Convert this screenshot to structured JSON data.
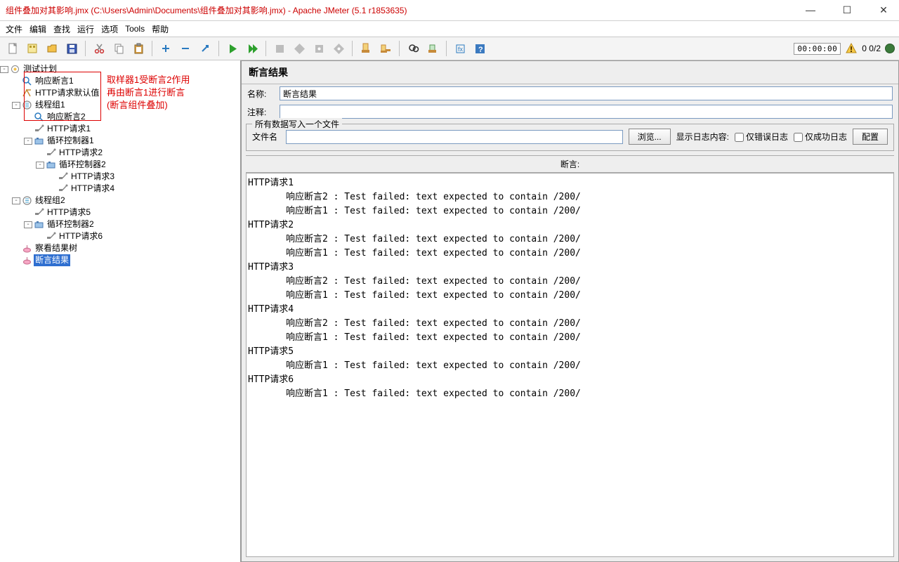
{
  "window": {
    "title": "组件叠加对其影响.jmx (C:\\Users\\Admin\\Documents\\组件叠加对其影响.jmx) - Apache JMeter (5.1 r1853635)"
  },
  "menu": {
    "file": "文件",
    "edit": "编辑",
    "search": "查找",
    "run": "运行",
    "options": "选项",
    "tools": "Tools",
    "help": "帮助"
  },
  "status": {
    "timer": "00:00:00",
    "counter": "0 0/2"
  },
  "annotation": {
    "line1": "取样器1受断言2作用",
    "line2": "再由断言1进行断言",
    "line3": "(断言组件叠加)"
  },
  "tree": {
    "root": "测试计划",
    "n1": "响应断言1",
    "n2": "HTTP请求默认值",
    "n3": "线程组1",
    "n3a": "响应断言2",
    "n3b": "HTTP请求1",
    "n3c": "循环控制器1",
    "n3c1": "HTTP请求2",
    "n3c2": "循环控制器2",
    "n3c2a": "HTTP请求3",
    "n3c2b": "HTTP请求4",
    "n4": "线程组2",
    "n4a": "HTTP请求5",
    "n4b": "循环控制器2",
    "n4b1": "HTTP请求6",
    "n5": "察看结果树",
    "n6": "断言结果"
  },
  "panel": {
    "title": "断言结果",
    "name_label": "名称:",
    "name_value": "断言结果",
    "comment_label": "注释:",
    "comment_value": "",
    "group_legend": "所有数据写入一个文件",
    "filename_label": "文件名",
    "filename_value": "",
    "browse_btn": "浏览...",
    "showlog_label": "显示日志内容:",
    "only_error": "仅错误日志",
    "only_success": "仅成功日志",
    "configure_btn": "配置",
    "assert_section": "断言:"
  },
  "results": [
    {
      "sampler": "HTTP请求1",
      "fails": [
        "响应断言2 : Test failed: text expected to contain /200/",
        "响应断言1 : Test failed: text expected to contain /200/"
      ]
    },
    {
      "sampler": "HTTP请求2",
      "fails": [
        "响应断言2 : Test failed: text expected to contain /200/",
        "响应断言1 : Test failed: text expected to contain /200/"
      ]
    },
    {
      "sampler": "HTTP请求3",
      "fails": [
        "响应断言2 : Test failed: text expected to contain /200/",
        "响应断言1 : Test failed: text expected to contain /200/"
      ]
    },
    {
      "sampler": "HTTP请求4",
      "fails": [
        "响应断言2 : Test failed: text expected to contain /200/",
        "响应断言1 : Test failed: text expected to contain /200/"
      ]
    },
    {
      "sampler": "HTTP请求5",
      "fails": [
        "响应断言1 : Test failed: text expected to contain /200/"
      ]
    },
    {
      "sampler": "HTTP请求6",
      "fails": [
        "响应断言1 : Test failed: text expected to contain /200/"
      ]
    }
  ]
}
